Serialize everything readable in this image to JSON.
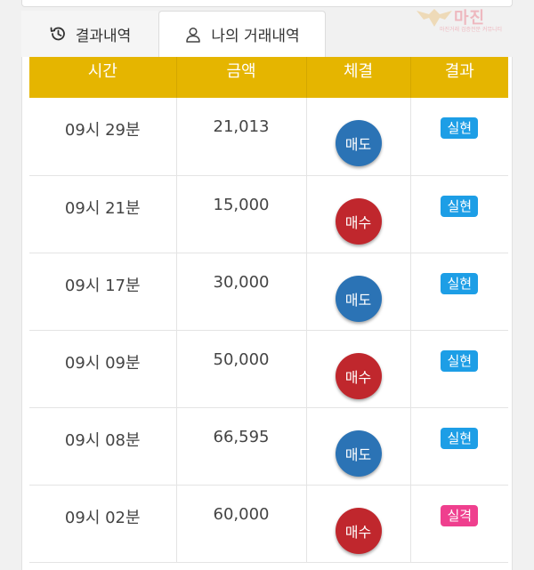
{
  "tabs": [
    {
      "label": "결과내역",
      "icon": "history-icon"
    },
    {
      "label": "나의 거래내역",
      "icon": "user-icon"
    }
  ],
  "watermark": {
    "main": "마진",
    "sub": "마진거래 검증전문 커뮤니티"
  },
  "table": {
    "headers": [
      "시간",
      "금액",
      "체결",
      "결과"
    ],
    "rows": [
      {
        "time": "09시 29분",
        "amount": "21,013",
        "trade": "매도",
        "result": "실현"
      },
      {
        "time": "09시 21분",
        "amount": "15,000",
        "trade": "매수",
        "result": "실현"
      },
      {
        "time": "09시 17분",
        "amount": "30,000",
        "trade": "매도",
        "result": "실현"
      },
      {
        "time": "09시 09분",
        "amount": "50,000",
        "trade": "매수",
        "result": "실현"
      },
      {
        "time": "09시 08분",
        "amount": "66,595",
        "trade": "매도",
        "result": "실현"
      },
      {
        "time": "09시 02분",
        "amount": "60,000",
        "trade": "매수",
        "result": "실격"
      }
    ]
  },
  "colors": {
    "header_bg": "#e5b500",
    "sell": "#2b73b5",
    "buy": "#c0272d",
    "badge_win": "#1d9ee6",
    "badge_lose": "#ef3f8e"
  }
}
